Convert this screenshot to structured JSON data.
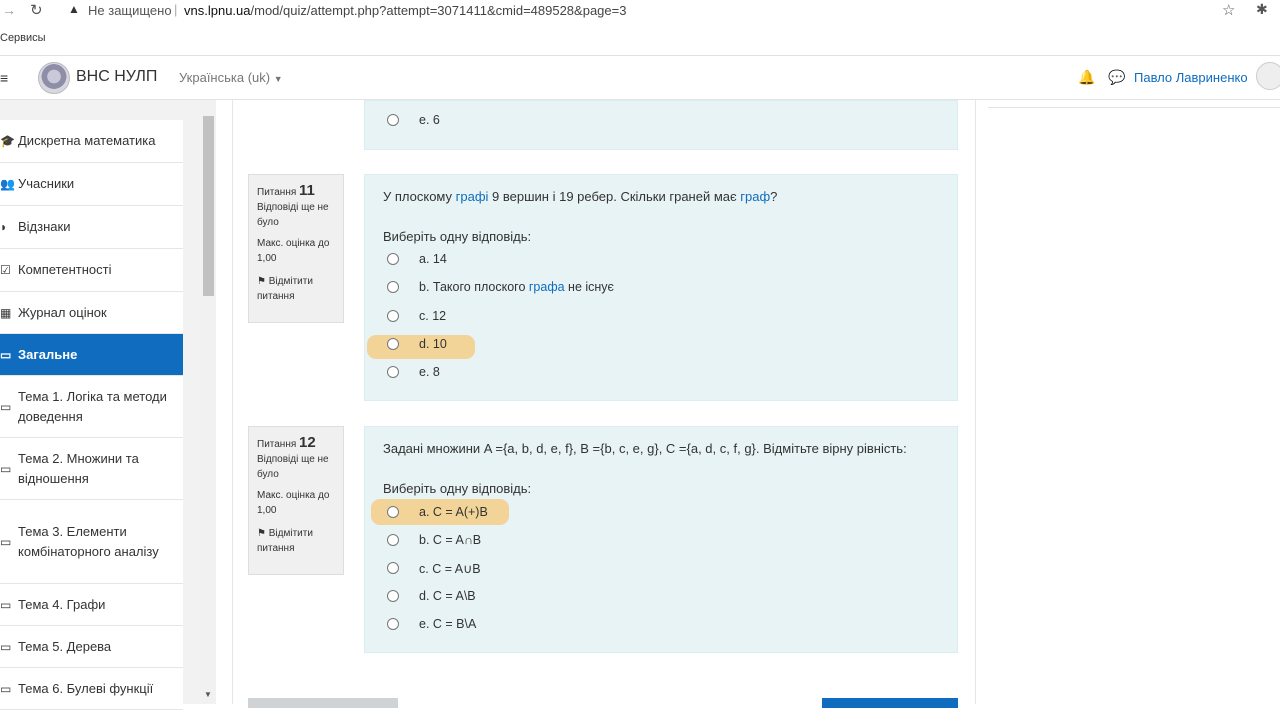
{
  "browser": {
    "insecure_label": "Не защищено",
    "separator": "|",
    "url_domain": "vns.lpnu.ua",
    "url_path": "/mod/quiz/attempt.php?attempt=3071411&cmid=489528&page=3",
    "bookmarks_label": "Сервисы"
  },
  "navbar": {
    "site_name": "ВНС НУЛП",
    "language": "Українська (uk)",
    "user_name": "Павло Лавриненко"
  },
  "sidebar": {
    "items": [
      {
        "label": "Дискретна математика",
        "icon": "graduation-cap-icon",
        "glyph": "🎓"
      },
      {
        "label": "Учасники",
        "icon": "users-icon",
        "glyph": "👥"
      },
      {
        "label": "Відзнаки",
        "icon": "badge-icon",
        "glyph": "◗"
      },
      {
        "label": "Компетентності",
        "icon": "check-square-icon",
        "glyph": "☑"
      },
      {
        "label": "Журнал оцінок",
        "icon": "table-icon",
        "glyph": "▦"
      },
      {
        "label": "Загальне",
        "icon": "folder-icon",
        "glyph": "▭",
        "active": true
      },
      {
        "label": "Тема 1. Логіка та методи доведення",
        "icon": "folder-icon",
        "glyph": "▭"
      },
      {
        "label": "Тема 2. Множини та відношення",
        "icon": "folder-icon",
        "glyph": "▭"
      },
      {
        "label": "Тема 3. Елементи комбінаторного аналізу",
        "icon": "folder-icon",
        "glyph": "▭"
      },
      {
        "label": "Тема 4. Графи",
        "icon": "folder-icon",
        "glyph": "▭"
      },
      {
        "label": "Тема 5. Дерева",
        "icon": "folder-icon",
        "glyph": "▭"
      },
      {
        "label": "Тема 6. Булеві функції",
        "icon": "folder-icon",
        "glyph": "▭"
      }
    ]
  },
  "prev_question": {
    "last_option": "e. 6"
  },
  "questions": [
    {
      "label": "Питання",
      "number": "11",
      "status": "Відповіді ще не було",
      "max_grade": "Макс. оцінка до 1,00",
      "flag": "Відмітити питання",
      "text_parts": [
        "У плоскому ",
        "графі",
        " 9 вершин і 19 ребер. Скільки граней має ",
        "граф",
        "?"
      ],
      "prompt": "Виберіть одну відповідь:",
      "options": [
        {
          "text": "a. 14"
        },
        {
          "text_parts": [
            "b. Такого плоского ",
            "графа",
            " не існує"
          ]
        },
        {
          "text": "c. 12"
        },
        {
          "text": "d. 10",
          "highlighted": true
        },
        {
          "text": "e. 8"
        }
      ]
    },
    {
      "label": "Питання",
      "number": "12",
      "status": "Відповіді ще не було",
      "max_grade": "Макс. оцінка до 1,00",
      "flag": "Відмітити питання",
      "text": "Задані множини A ={a, b, d, e, f}, B ={b, c, e, g}, C ={a, d, c, f, g}. Відмітьте вірну рівність:",
      "prompt": "Виберіть одну відповідь:",
      "options": [
        {
          "text": "a. C = A(+)B",
          "highlighted": true
        },
        {
          "text": "b. C = A∩B"
        },
        {
          "text": "c. C = A∪B"
        },
        {
          "text": "d. C = A\\B"
        },
        {
          "text": "e. C = B\\A"
        }
      ]
    }
  ],
  "colors": {
    "accent": "#0f6cbf",
    "answer_bg": "#e7f3f5",
    "highlight": "#f5c97a"
  }
}
